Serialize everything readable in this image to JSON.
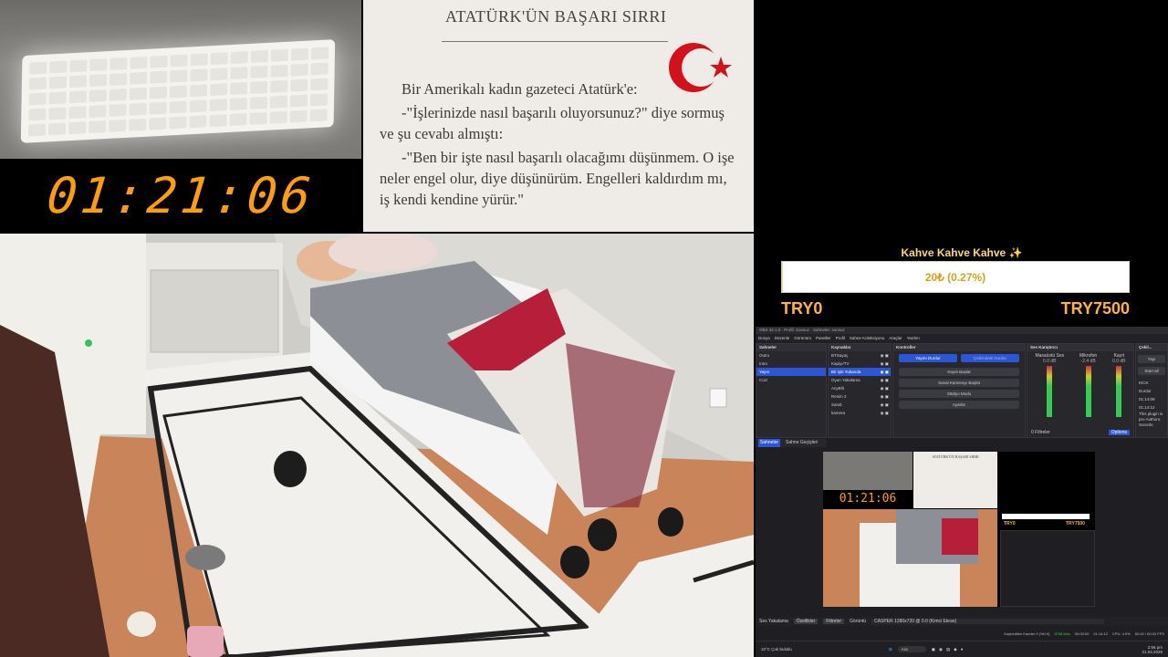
{
  "timer": {
    "value": "01:21:06"
  },
  "book": {
    "title": "ATATÜRK'ÜN BAŞARI SIRRI",
    "line1": "Bir Amerikalı kadın gazeteci Atatürk'e:",
    "line2": "-\"İşlerinizde nasıl başarılı oluyorsunuz?\" diye sormuş",
    "line3": "ve şu cevabı almıştı:",
    "line4": "-\"Ben bir işte nasıl başarılı olacağımı düşünmem. O işe",
    "line5": "neler engel olur, diye düşünürüm. Engelleri kaldırdım mı,",
    "line6": "iş kendi kendine yürür.\""
  },
  "donation": {
    "title": "Kahve Kahve Kahve ✨",
    "amount": "20₺ (0.27%)",
    "progress": 0.0027,
    "min": "TRY0",
    "max": "TRY7500"
  },
  "obs": {
    "window_title": "OBS 32.1.0 - Profil: Sonsuz - Sahneler: sonsuz",
    "menu": [
      "Dosya",
      "Düzenle",
      "Görünüm",
      "Paneller",
      "Profil",
      "Sahne Koleksiyonu",
      "Araçlar",
      "Yardım"
    ],
    "scenes_header": "Sahneler",
    "scenes": [
      "Outro",
      "Intro",
      "Yayın",
      "Cozi"
    ],
    "sources_header": "Kaynaklar",
    "sources": [
      "BTSayaç",
      "Kapiyı/TV",
      "Bir işin Yukarıda",
      "Oyun Yakalama",
      "AnyBlit",
      "Resim 2",
      "Sandi",
      "kamera"
    ],
    "controls_header": "Kontroller",
    "controls": {
      "stop_stream": "Yayını Durdur",
      "stop_record": "Çekimdeki Durdur",
      "start_record": "Kaydı Başlat",
      "virtual_cam": "Sanal Kamerayı Başlat",
      "studio": "Stüdyo Modu",
      "settings": "Ayarlar"
    },
    "mixer_header": "Ses Karıştırıcı",
    "mixer_channels": [
      "Masaüstü Ses",
      "Mikrofon",
      "Kayıt"
    ],
    "mixer_db": [
      "0.0 dB",
      "-2.4 dB",
      "0.0 dB"
    ],
    "side_header": "Çekil...",
    "side_buttons": [
      "Yayı",
      "Start all"
    ],
    "side_items": [
      "KICK",
      "Durdur",
      "01:14:09",
      "01:14:12"
    ],
    "side_text": "This plugin is pro Authors: Sorunlu",
    "tabs": [
      "Sahneler",
      "Sahne Geçişleri"
    ],
    "options": "Options",
    "filter": "0 Filtreler",
    "stats": {
      "live_label": "Ses Yakalama",
      "props_btn": "Özellikler",
      "filters_btn": "Filtreler",
      "device_label": "Görüntü",
      "device": "CASPER 1280x720 @ 0.0 (Kimci Ekran)",
      "dropped": "Kaybedilen Kareler 0 (%0.0)",
      "bitrate": "5738 kb/s",
      "live_time": "00:00:00",
      "rec_time": "01:14:12",
      "cpu": "CPU: 4.9%",
      "fps": "60.00 / 60.00 FPS"
    },
    "taskbar": {
      "weather": "10°C Çok bulutlu",
      "search": "Ara",
      "time": "2:56 pm",
      "date": "21.04.2025"
    }
  },
  "preview": {
    "timer": "01:21:06",
    "min": "TRY0",
    "max": "TRY7500",
    "book_title": "ATATÜRK'ÜN BAŞARI SIRRI"
  }
}
